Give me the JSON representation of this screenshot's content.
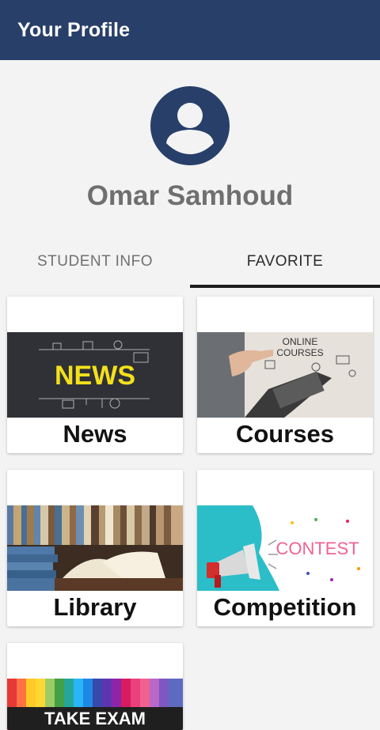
{
  "appbar": {
    "title": "Your Profile"
  },
  "profile": {
    "name": "Omar Samhoud"
  },
  "tabs": [
    {
      "label": "STUDENT INFO",
      "selected": false
    },
    {
      "label": "FAVORITE",
      "selected": true
    }
  ],
  "cards": [
    {
      "label": "News",
      "image_text": "NEWS"
    },
    {
      "label": "Courses",
      "image_text_1": "ONLINE",
      "image_text_2": "COURSES"
    },
    {
      "label": "Library"
    },
    {
      "label": "Competition",
      "image_text": "CONTEST"
    },
    {
      "label": "",
      "image_text": "TAKE EXAM"
    }
  ],
  "colors": {
    "appbar": "#283f69",
    "background": "#f3f3f3",
    "tab_indicator": "#1d1d1d"
  }
}
